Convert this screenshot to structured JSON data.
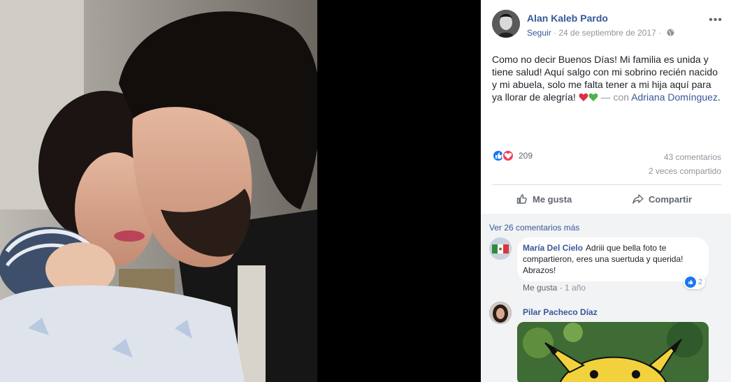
{
  "post": {
    "author": "Alan Kaleb Pardo",
    "follow_label": "Seguir",
    "separator": "·",
    "date": "24 de septiembre de 2017",
    "separator2": "·",
    "more_label": "•••",
    "text": "Como no decir Buenos Días! Mi familia es unida y tiene salud! Aquí salgo con mi sobrino recién nacido y mi abuela, solo me falta tener a mi hija aquí para ya llorar de alegría! ",
    "with_text": "— con",
    "tagged": "Adriana Domínguez",
    "tagged_suffix": "."
  },
  "stats": {
    "reactions": "209",
    "comments": "43 comentarios",
    "shares": "2 veces compartido"
  },
  "actions": {
    "like": "Me gusta",
    "share": "Compartir"
  },
  "comments": {
    "view_more": "Ver 26 comentarios más",
    "items": [
      {
        "author": "María Del Cielo",
        "text": "Adriii que bella foto te compartieron, eres una suertuda y querida! Abrazos!",
        "reaction_count": "2",
        "like_label": "Me gusta",
        "separator": "·",
        "time": "1 año"
      },
      {
        "author": "Pilar Pacheco Díaz"
      }
    ]
  },
  "colors": {
    "link": "#365899",
    "like_blue": "#1877f2",
    "love_red": "#f33e58",
    "muted": "#90949c"
  },
  "icons": {
    "globe": "globe-icon",
    "thumbs_up": "thumbs-up-icon",
    "share": "share-arrow-icon",
    "more": "more-options-icon"
  }
}
